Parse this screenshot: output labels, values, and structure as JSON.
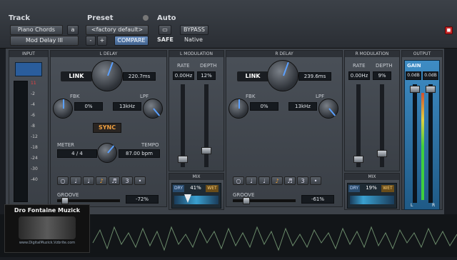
{
  "header": {
    "track_label": "Track",
    "preset_label": "Preset",
    "auto_label": "Auto",
    "track_name": "Piano Chords",
    "track_slot": "a",
    "plugin_name": "Mod Delay III",
    "preset_name": "<factory default>",
    "compare_label": "COMPARE",
    "safe_label": "SAFE",
    "bypass_label": "BYPASS",
    "native_label": "Native",
    "minus_label": "-",
    "plus_label": "+"
  },
  "sections": {
    "input": "INPUT",
    "l_delay": "L DELAY",
    "l_mod": "L MODULATION",
    "r_delay": "R DELAY",
    "r_mod": "R MODULATION",
    "output": "OUTPUT",
    "mix_l": "MIX",
    "mix_r": "MIX"
  },
  "left": {
    "link": "LINK",
    "delay": "220.7ms",
    "fbk_label": "FBK",
    "fbk": "0%",
    "lpf_label": "LPF",
    "lpf": "13kHz",
    "sync": "SYNC",
    "meter_label": "METER",
    "tempo_label": "TEMPO",
    "meter_num": "4",
    "meter_slash": "/",
    "meter_den": "4",
    "tempo": "87.00 bpm",
    "rate_label": "RATE",
    "depth_label": "DEPTH",
    "rate": "0.00Hz",
    "depth": "12%",
    "groove_label": "GROOVE",
    "groove": "-72%",
    "dry": "DRY",
    "mix": "41%",
    "wet": "WET"
  },
  "right": {
    "link": "LINK",
    "delay": "239.6ms",
    "fbk_label": "FBK",
    "fbk": "0%",
    "lpf_label": "LPF",
    "lpf": "13kHz",
    "rate_label": "RATE",
    "depth_label": "DEPTH",
    "rate": "0.00Hz",
    "depth": "9%",
    "groove_label": "GROOVE",
    "groove": "-61%",
    "dry": "DRY",
    "mix": "19%",
    "wet": "WET"
  },
  "output": {
    "gain_label": "GAIN",
    "gain_l": "0.0dB",
    "gain_r": "0.0dB",
    "l_label": "L",
    "r_label": "R"
  },
  "note_buttons": [
    "○",
    "♩",
    "♩",
    "♪",
    "♬",
    "3",
    "•"
  ],
  "note_selected_index": 3,
  "meter_scale": [
    "11",
    "-2",
    "-4",
    "-6",
    "-8",
    "-12",
    "-18",
    "-24",
    "-30",
    "-40"
  ],
  "logo": {
    "title": "Dro Fontaine Muzick",
    "url": "www.DigitalMuzick.Vzbrite.com"
  },
  "colors": {
    "accent_blue": "#2a6ad6",
    "sync_orange": "#e08a2a",
    "meter_green": "#3ecf3e",
    "waveform_green": "#6a8a6a"
  }
}
